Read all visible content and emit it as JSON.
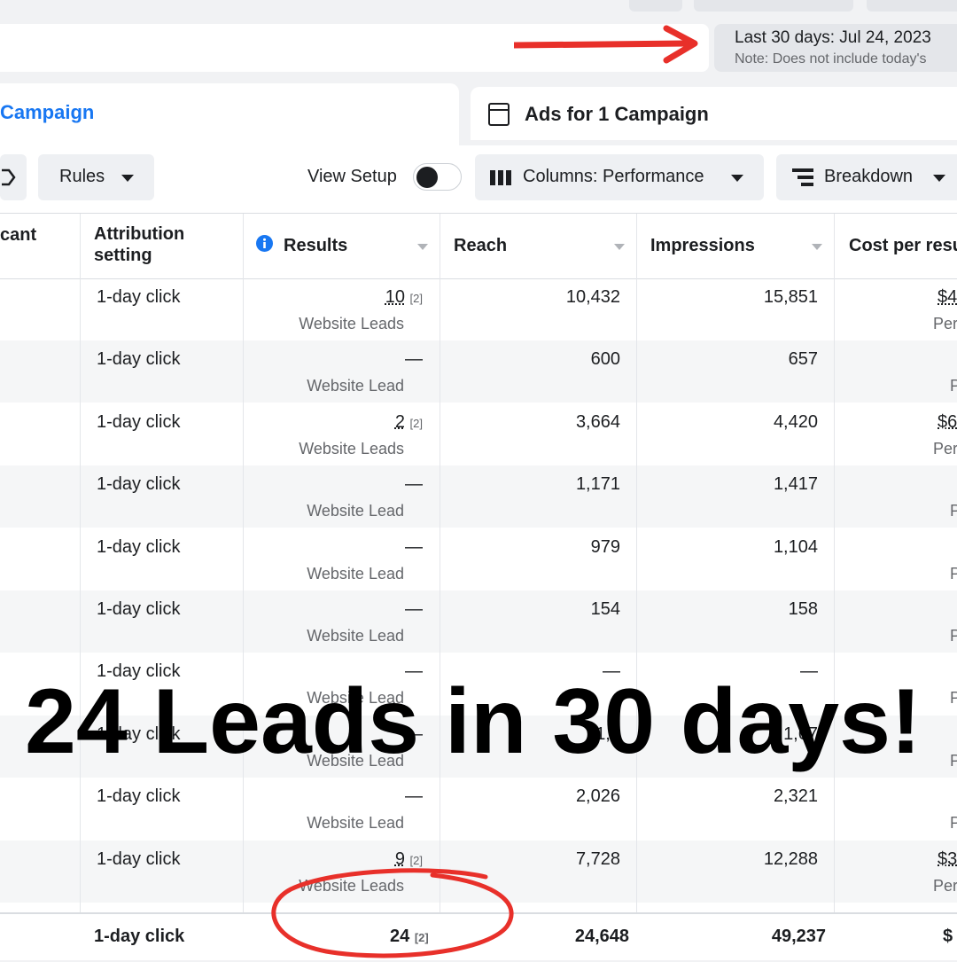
{
  "header": {
    "date_range": "Last 30 days: Jul 24, 2023",
    "date_note": "Note: Does not include today's"
  },
  "tabs": [
    {
      "label": "Campaign"
    },
    {
      "label": "Ads for 1 Campaign"
    }
  ],
  "toolbar": {
    "rules_label": "Rules",
    "view_setup_label": "View Setup",
    "columns_label": "Columns: Performance",
    "breakdown_label": "Breakdown"
  },
  "table": {
    "columns": [
      "cant",
      "Attribution setting",
      "Results",
      "Reach",
      "Impressions",
      "Cost per resu"
    ],
    "rows": [
      {
        "attribution": "1-day click",
        "results": "10",
        "results_fn": "[2]",
        "results_sub": "Website Leads",
        "reach": "10,432",
        "impressions": "15,851",
        "cost": "$4",
        "cost_sub": "Per"
      },
      {
        "attribution": "1-day click",
        "results": "—",
        "results_fn": "",
        "results_sub": "Website Lead",
        "reach": "600",
        "impressions": "657",
        "cost": "",
        "cost_sub": "P"
      },
      {
        "attribution": "1-day click",
        "results": "2",
        "results_fn": "[2]",
        "results_sub": "Website Leads",
        "reach": "3,664",
        "impressions": "4,420",
        "cost": "$6",
        "cost_sub": "Per"
      },
      {
        "attribution": "1-day click",
        "results": "—",
        "results_fn": "",
        "results_sub": "Website Lead",
        "reach": "1,171",
        "impressions": "1,417",
        "cost": "",
        "cost_sub": "P"
      },
      {
        "attribution": "1-day click",
        "results": "—",
        "results_fn": "",
        "results_sub": "Website Lead",
        "reach": "979",
        "impressions": "1,104",
        "cost": "",
        "cost_sub": "P"
      },
      {
        "attribution": "1-day click",
        "results": "—",
        "results_fn": "",
        "results_sub": "Website Lead",
        "reach": "154",
        "impressions": "158",
        "cost": "",
        "cost_sub": "P"
      },
      {
        "attribution": "1-day click",
        "results": "—",
        "results_fn": "",
        "results_sub": "Website Lead",
        "reach": "—",
        "impressions": "—",
        "cost": "",
        "cost_sub": "P"
      },
      {
        "attribution": "1-day click",
        "results": "—",
        "results_fn": "",
        "results_sub": "Website Lead",
        "reach": "1,1",
        "impressions": "1,67",
        "cost": "",
        "cost_sub": "P"
      },
      {
        "attribution": "1-day click",
        "results": "—",
        "results_fn": "",
        "results_sub": "Website Lead",
        "reach": "2,026",
        "impressions": "2,321",
        "cost": "",
        "cost_sub": "P"
      },
      {
        "attribution": "1-day click",
        "results": "9",
        "results_fn": "[2]",
        "results_sub": "Website Leads",
        "reach": "7,728",
        "impressions": "12,288",
        "cost": "$3",
        "cost_sub": "Per"
      }
    ],
    "total": {
      "attribution": "1-day click",
      "results": "24",
      "results_fn": "[2]",
      "reach": "24,648",
      "impressions": "49,237",
      "cost": "$"
    }
  },
  "overlay": {
    "headline": "24 Leads in 30 days!",
    "arrow_color": "#e8302a",
    "circle_color": "#e8302a"
  }
}
